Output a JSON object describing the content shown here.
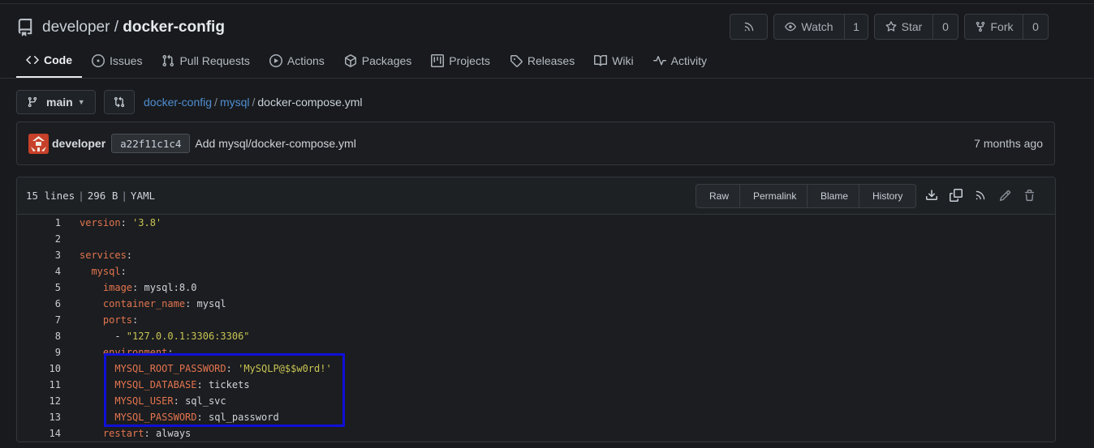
{
  "repo": {
    "owner": "developer",
    "separator": "/",
    "name": "docker-config"
  },
  "header_buttons": {
    "watch_label": "Watch",
    "watch_count": "1",
    "star_label": "Star",
    "star_count": "0",
    "fork_label": "Fork",
    "fork_count": "0"
  },
  "tabs": [
    {
      "label": "Code",
      "icon": "code-icon",
      "active": true
    },
    {
      "label": "Issues",
      "icon": "issue-icon"
    },
    {
      "label": "Pull Requests",
      "icon": "pull-request-icon"
    },
    {
      "label": "Actions",
      "icon": "play-icon"
    },
    {
      "label": "Packages",
      "icon": "package-icon"
    },
    {
      "label": "Projects",
      "icon": "project-icon"
    },
    {
      "label": "Releases",
      "icon": "tag-icon"
    },
    {
      "label": "Wiki",
      "icon": "book-icon"
    },
    {
      "label": "Activity",
      "icon": "pulse-icon"
    }
  ],
  "branch": {
    "name": "main"
  },
  "breadcrumb": {
    "root": "docker-config",
    "folder": "mysql",
    "file": "docker-compose.yml",
    "sep": "/"
  },
  "commit": {
    "user": "developer",
    "sha": "a22f11c1c4",
    "message": "Add mysql/docker-compose.yml",
    "time": "7 months ago"
  },
  "file": {
    "lines_info": "15 lines",
    "size": "296 B",
    "lang": "YAML",
    "buttons": {
      "raw": "Raw",
      "permalink": "Permalink",
      "blame": "Blame",
      "history": "History"
    }
  },
  "code_lines": [
    {
      "n": "1",
      "indent": "",
      "key": "version",
      "sep": ": ",
      "val": "'3.8'",
      "val_type": "s"
    },
    {
      "n": "2",
      "indent": "",
      "key": "",
      "sep": "",
      "val": "",
      "val_type": "p"
    },
    {
      "n": "3",
      "indent": "",
      "key": "services",
      "sep": ":",
      "val": "",
      "val_type": "p"
    },
    {
      "n": "4",
      "indent": "  ",
      "key": "mysql",
      "sep": ":",
      "val": "",
      "val_type": "p"
    },
    {
      "n": "5",
      "indent": "    ",
      "key": "image",
      "sep": ": ",
      "val": "mysql:8.0",
      "val_type": "p"
    },
    {
      "n": "6",
      "indent": "    ",
      "key": "container_name",
      "sep": ": ",
      "val": "mysql",
      "val_type": "p"
    },
    {
      "n": "7",
      "indent": "    ",
      "key": "ports",
      "sep": ":",
      "val": "",
      "val_type": "p"
    },
    {
      "n": "8",
      "indent": "      - ",
      "key": "",
      "sep": "",
      "val": "\"127.0.0.1:3306:3306\"",
      "val_type": "s"
    },
    {
      "n": "9",
      "indent": "    ",
      "key": "environment",
      "sep": ":",
      "val": "",
      "val_type": "p"
    },
    {
      "n": "10",
      "indent": "      ",
      "key": "MYSQL_ROOT_PASSWORD",
      "sep": ": ",
      "val": "'MySQLP@$$w0rd!'",
      "val_type": "s"
    },
    {
      "n": "11",
      "indent": "      ",
      "key": "MYSQL_DATABASE",
      "sep": ": ",
      "val": "tickets",
      "val_type": "p"
    },
    {
      "n": "12",
      "indent": "      ",
      "key": "MYSQL_USER",
      "sep": ": ",
      "val": "sql_svc",
      "val_type": "p"
    },
    {
      "n": "13",
      "indent": "      ",
      "key": "MYSQL_PASSWORD",
      "sep": ": ",
      "val": "sql_password",
      "val_type": "p"
    },
    {
      "n": "14",
      "indent": "    ",
      "key": "restart",
      "sep": ": ",
      "val": "always",
      "val_type": "p"
    }
  ],
  "colors": {
    "link": "#4f8ed1",
    "yaml_key": "#e4754f",
    "yaml_string": "#c9c454",
    "highlight_box": "#1010d8"
  }
}
